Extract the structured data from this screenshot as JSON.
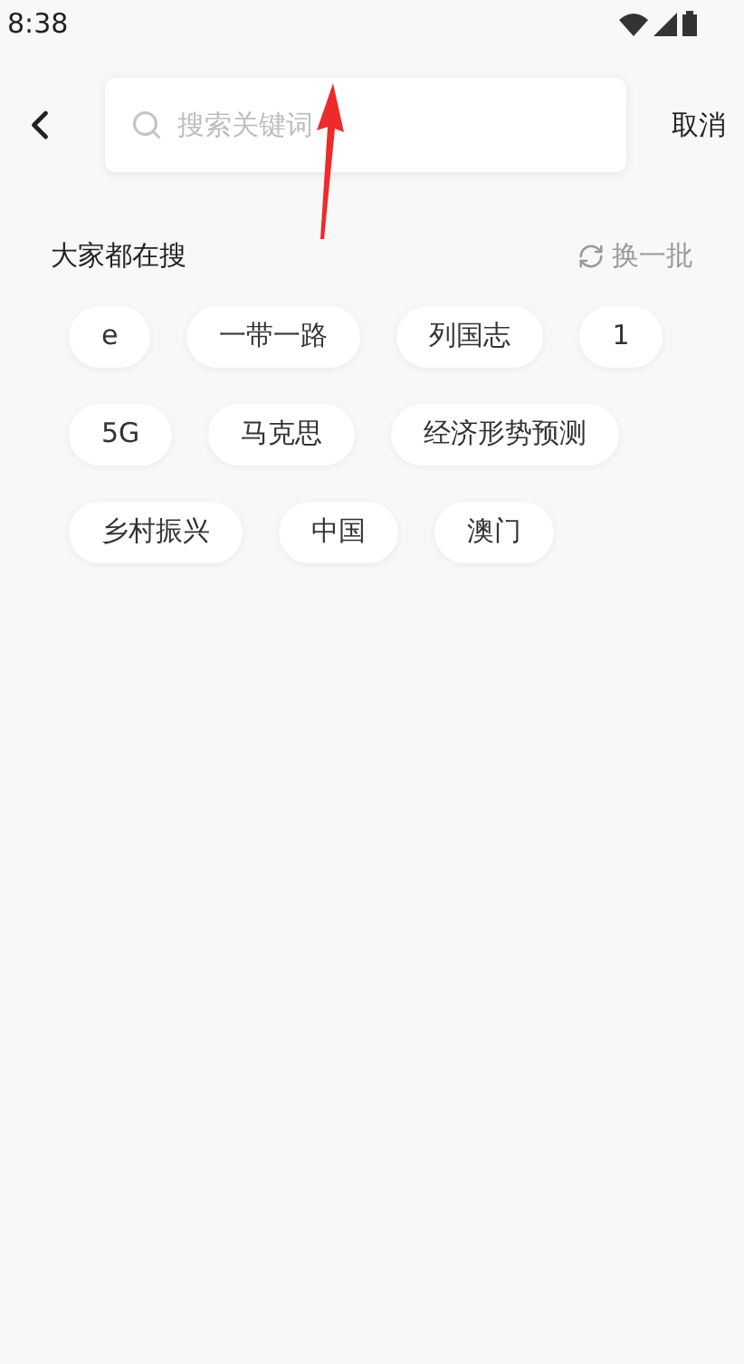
{
  "status_bar": {
    "time": "8:38"
  },
  "search": {
    "placeholder": "搜索关键词",
    "cancel": "取消"
  },
  "hot": {
    "title": "大家都在搜",
    "refresh": "换一批",
    "tags": [
      "e",
      "一带一路",
      "列国志",
      "1",
      "5G",
      "马克思",
      "经济形势预测",
      "乡村振兴",
      "中国",
      "澳门"
    ]
  }
}
